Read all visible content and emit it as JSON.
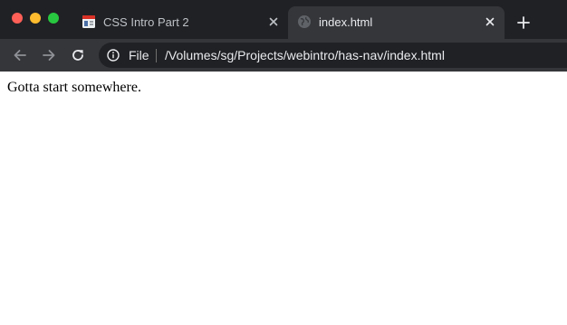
{
  "window_controls": {
    "close_color": "#fe5f57",
    "minimize_color": "#febc2e",
    "maximize_color": "#28c840"
  },
  "tabs": [
    {
      "title": "CSS Intro Part 2",
      "favicon": "document-page-icon",
      "active": false
    },
    {
      "title": "index.html",
      "favicon": "globe-icon",
      "active": true
    }
  ],
  "toolbar": {
    "back_icon": "back-arrow-icon",
    "forward_icon": "forward-arrow-icon",
    "reload_icon": "reload-icon"
  },
  "address_bar": {
    "site_info_icon": "info-icon",
    "scheme_label": "File",
    "url": "/Volumes/sg/Projects/webintro/has-nav/index.html"
  },
  "page": {
    "body_text": "Gotta start somewhere."
  },
  "colors": {
    "tabstrip_bg": "#202124",
    "toolbar_bg": "#35363a",
    "omnibox_bg": "#202124",
    "text_light": "#e8eaed"
  }
}
